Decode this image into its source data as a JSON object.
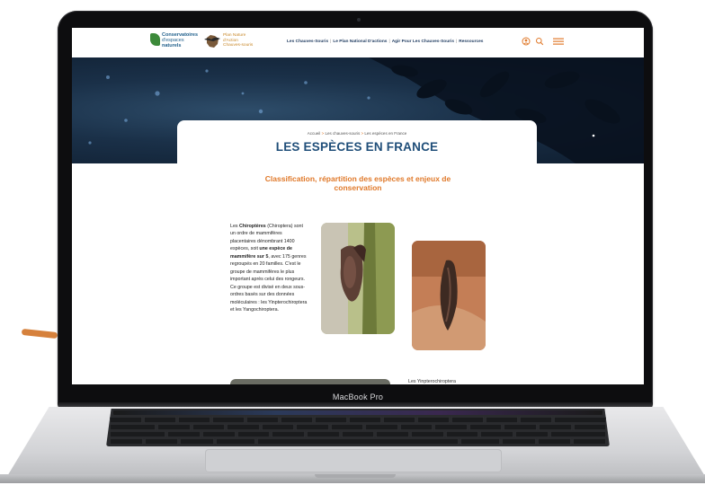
{
  "device": {
    "model_label": "MacBook Pro"
  },
  "site": {
    "logo_primary": [
      "Conservatoires",
      "d'espaces",
      "naturels"
    ],
    "logo_secondary": [
      "Plan Nature",
      "d'Action",
      "Chauves-souris"
    ],
    "nav": [
      "Les Chauves-Souris",
      "Le Plan National D'actions",
      "Agir Pour Les Chauves-Souris",
      "Ressources"
    ],
    "nav_separator": "|",
    "header_icons": [
      "user-icon",
      "search-icon",
      "menu-icon"
    ],
    "breadcrumb": [
      "Accueil",
      "Les chauves-souris",
      "Les espèces en France"
    ],
    "breadcrumb_separator": ">",
    "page_title": "LES ESPÈCES EN FRANCE",
    "subtitle": "Classification, répartition des espèces et enjeux de conservation",
    "paragraph_segments": [
      {
        "text": "Les ",
        "bold": false
      },
      {
        "text": "Chiroptères",
        "bold": true
      },
      {
        "text": " (Chiroptera) sont un ordre de mammifères placentaires dénombrant 1400 espèces, soit ",
        "bold": false
      },
      {
        "text": "une espèce de mammifère sur 5",
        "bold": true
      },
      {
        "text": ", avec 175 genres regroupés en 20 familles. C'est le groupe de mammifères le plus important après celui des rongeurs. Ce groupe est divisé en deux sous-ordres basés sur des données moléculaires : les Yinpterochiroptera et les Yangochiroptera.",
        "bold": false
      }
    ],
    "next_section_label": "Les Yinpterochiroptera"
  },
  "colors": {
    "accent_orange": "#e0792a",
    "title_blue": "#1f4e79",
    "logo_green": "#3c8a3a"
  }
}
